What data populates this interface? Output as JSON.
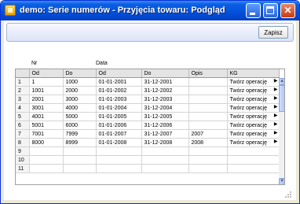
{
  "window": {
    "title": "demo: Serie numerów - Przyjęcia towaru: Podgląd",
    "icon": "app-icon"
  },
  "toolbar": {
    "save_label": "Zapisz"
  },
  "groups": {
    "nr": "Nr",
    "data": "Data"
  },
  "table": {
    "columns": [
      "",
      "Od",
      "Do",
      "Od",
      "Do",
      "Opis",
      "KG"
    ],
    "rows": [
      [
        "1",
        "1",
        "1000",
        "01-01-2001",
        "31-12-2001",
        "",
        "Twórz operację"
      ],
      [
        "2",
        "1001",
        "2000",
        "01-01-2002",
        "31-12-2002",
        "",
        "Twórz operację"
      ],
      [
        "3",
        "2001",
        "3000",
        "01-01-2003",
        "31-12-2003",
        "",
        "Twórz operację"
      ],
      [
        "4",
        "3001",
        "4000",
        "01-01-2004",
        "31-12-2004",
        "",
        "Twórz operację"
      ],
      [
        "5",
        "4001",
        "5000",
        "01-01-2005",
        "31-12-2005",
        "",
        "Twórz operację"
      ],
      [
        "6",
        "5001",
        "6000",
        "01-01-2006",
        "31-12-2006",
        "",
        "Twórz operację"
      ],
      [
        "7",
        "7001",
        "7999",
        "01-01-2007",
        "31-12-2007",
        "2007",
        "Twórz operację"
      ],
      [
        "8",
        "8000",
        "8999",
        "01-01-2008",
        "31-12-2008",
        "2008",
        "Twórz operację"
      ],
      [
        "9",
        "",
        "",
        "",
        "",
        "",
        ""
      ],
      [
        "10",
        "",
        "",
        "",
        "",
        "",
        ""
      ],
      [
        "11",
        "",
        "",
        "",
        "",
        "",
        ""
      ]
    ]
  },
  "colors": {
    "titlebar": "#0554de",
    "close": "#c63b12",
    "frame": "#0831d9"
  }
}
